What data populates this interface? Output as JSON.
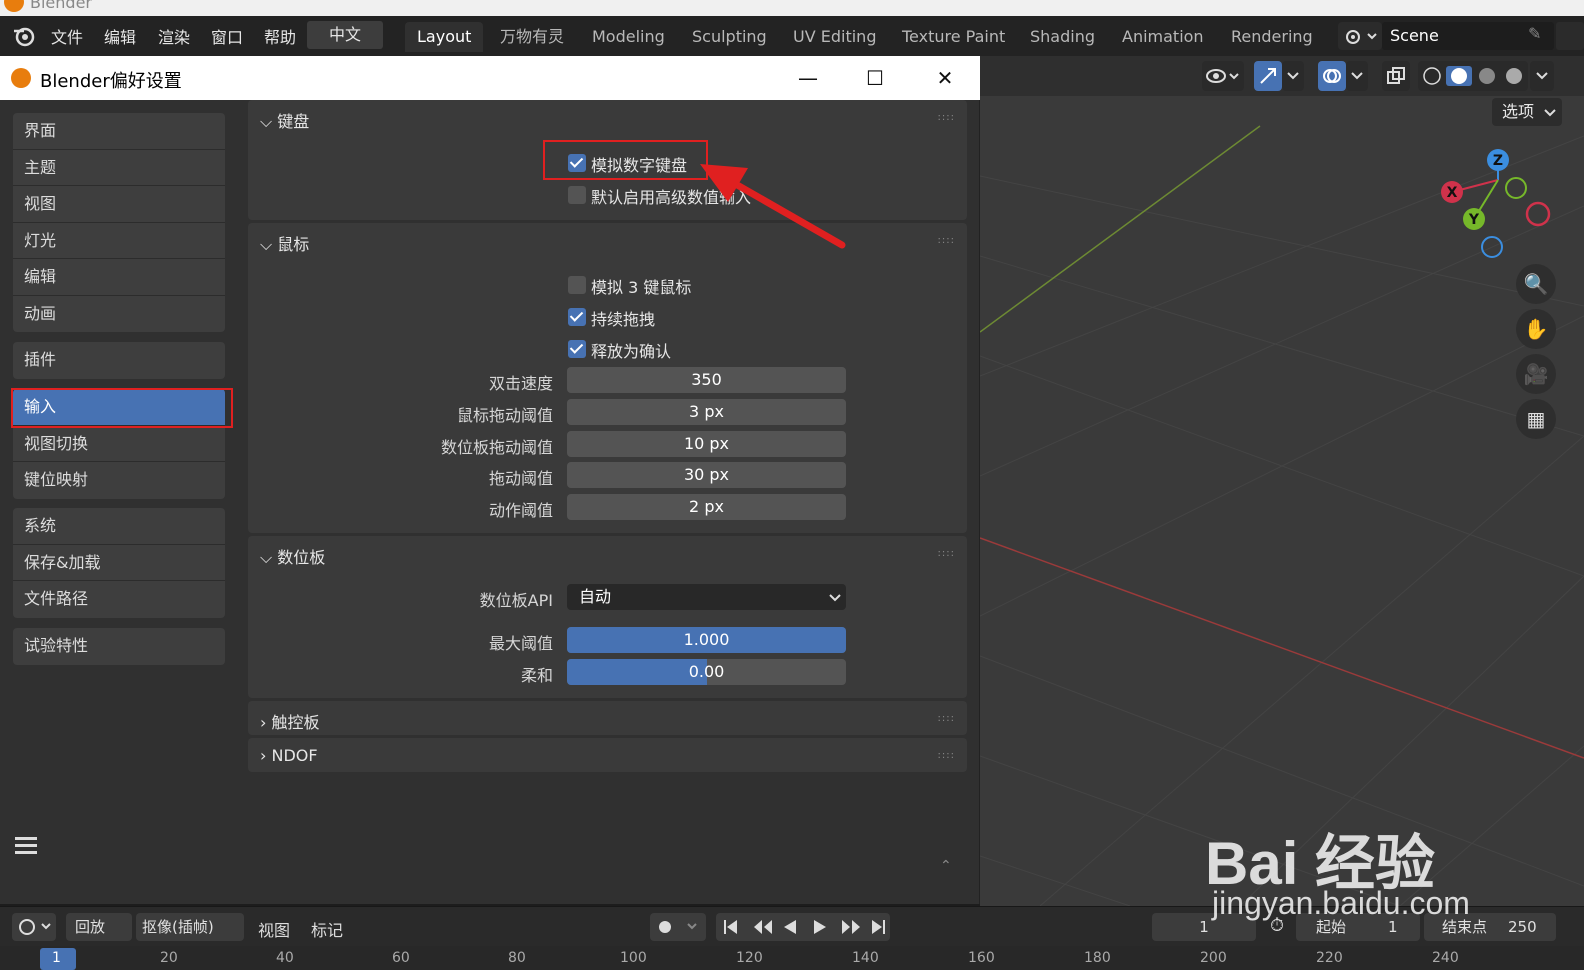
{
  "os_window": {
    "title": "Blender"
  },
  "menubar": {
    "items": [
      "文件",
      "编辑",
      "渲染",
      "窗口",
      "帮助"
    ],
    "language_button": "中文",
    "workspace_tabs": [
      "Layout",
      "万物有灵",
      "Modeling",
      "Sculpting",
      "UV Editing",
      "Texture Paint",
      "Shading",
      "Animation",
      "Rendering"
    ],
    "active_tab": "Layout",
    "scene_name": "Scene"
  },
  "viewport": {
    "options_label": "选项",
    "gizmo_axes": [
      "Z",
      "X",
      "Y"
    ],
    "axis_colors": {
      "x": "#d0324b",
      "y": "#76b82a",
      "z": "#3b8ee0"
    }
  },
  "preferences": {
    "window_title": "Blender偏好设置",
    "nav_groups": [
      [
        "界面",
        "主题",
        "视图",
        "灯光",
        "编辑",
        "动画"
      ],
      [
        "插件"
      ],
      [
        "输入",
        "视图切换",
        "键位映射"
      ],
      [
        "系统",
        "保存&加载",
        "文件路径"
      ],
      [
        "试验特性"
      ]
    ],
    "active_nav": "输入",
    "keyboard": {
      "title": "键盘",
      "emulate_numpad": {
        "label": "模拟数字键盘",
        "checked": true
      },
      "default_numeric_input": {
        "label": "默认启用高级数值输入",
        "checked": false
      }
    },
    "mouse": {
      "title": "鼠标",
      "emulate_3button": {
        "label": "模拟 3 键鼠标",
        "checked": false
      },
      "continuous_grab": {
        "label": "持续拖拽",
        "checked": true
      },
      "release_confirms": {
        "label": "释放为确认",
        "checked": true
      },
      "fields": [
        {
          "label": "双击速度",
          "value": "350"
        },
        {
          "label": "鼠标拖动阈值",
          "value": "3 px"
        },
        {
          "label": "数位板拖动阈值",
          "value": "10 px"
        },
        {
          "label": "拖动阈值",
          "value": "30 px"
        },
        {
          "label": "动作阈值",
          "value": "2 px"
        }
      ]
    },
    "tablet": {
      "title": "数位板",
      "api_label": "数位板API",
      "api_value": "自动",
      "max_threshold": {
        "label": "最大阈值",
        "value": "1.000",
        "fraction": 1.0
      },
      "softness": {
        "label": "柔和",
        "value": "0.00",
        "fraction": 0.5
      }
    },
    "touchpad": {
      "title": "触控板"
    },
    "ndof": {
      "title": "NDOF"
    },
    "accent": "#4772b3",
    "highlight": "#e02020"
  },
  "timeline": {
    "playback": "回放",
    "keying": "抠像(插帧)",
    "view": "视图",
    "marker": "标记",
    "current_frame": "1",
    "start_label": "起始",
    "start_value": "1",
    "end_label": "结束点",
    "end_value": "250",
    "ruler": [
      "1",
      "20",
      "40",
      "60",
      "80",
      "100",
      "120",
      "140",
      "160",
      "180",
      "200",
      "220",
      "240"
    ]
  },
  "watermark": {
    "brand": "Bai  经验",
    "url": "jingyan.baidu.com"
  }
}
